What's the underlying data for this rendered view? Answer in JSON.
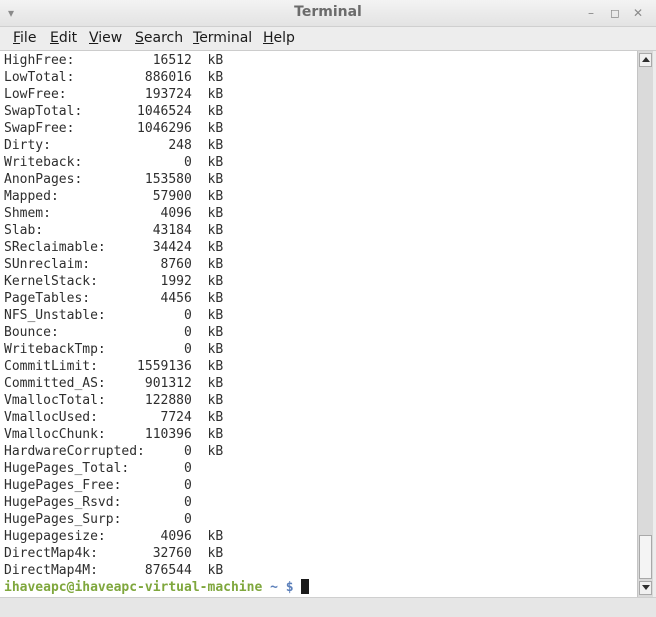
{
  "window": {
    "title": "Terminal",
    "controls": {
      "menu_glyph": "▾",
      "minimize_glyph": "–",
      "maximize_glyph": "◻",
      "close_glyph": "✕"
    }
  },
  "menubar": {
    "items": [
      {
        "mnemonic": "F",
        "rest": "ile"
      },
      {
        "mnemonic": "E",
        "rest": "dit"
      },
      {
        "mnemonic": "V",
        "rest": "iew"
      },
      {
        "mnemonic": "S",
        "rest": "earch"
      },
      {
        "mnemonic": "T",
        "rest": "erminal"
      },
      {
        "mnemonic": "H",
        "rest": "elp"
      }
    ]
  },
  "terminal": {
    "lines": [
      "HighFree:          16512  kB",
      "LowTotal:         886016  kB",
      "LowFree:          193724  kB",
      "SwapTotal:       1046524  kB",
      "SwapFree:        1046296  kB",
      "Dirty:               248  kB",
      "Writeback:             0  kB",
      "AnonPages:        153580  kB",
      "Mapped:            57900  kB",
      "Shmem:              4096  kB",
      "Slab:              43184  kB",
      "SReclaimable:      34424  kB",
      "SUnreclaim:         8760  kB",
      "KernelStack:        1992  kB",
      "PageTables:         4456  kB",
      "NFS_Unstable:          0  kB",
      "Bounce:                0  kB",
      "WritebackTmp:          0  kB",
      "CommitLimit:     1559136  kB",
      "Committed_AS:     901312  kB",
      "VmallocTotal:     122880  kB",
      "VmallocUsed:        7724  kB",
      "VmallocChunk:     110396  kB",
      "HardwareCorrupted:     0  kB",
      "HugePages_Total:       0",
      "HugePages_Free:        0",
      "HugePages_Rsvd:        0",
      "HugePages_Surp:        0",
      "Hugepagesize:       4096  kB",
      "DirectMap4k:       32760  kB",
      "DirectMap4M:      876544  kB"
    ],
    "prompt": {
      "user_host": "ihaveapc@ihaveapc-virtual-machine",
      "path": " ~ $",
      "input": " "
    }
  },
  "colors": {
    "prompt_user": "#7fa73d",
    "prompt_path": "#5b7fba",
    "text": "#2e2e2e",
    "background": "#ffffff"
  }
}
